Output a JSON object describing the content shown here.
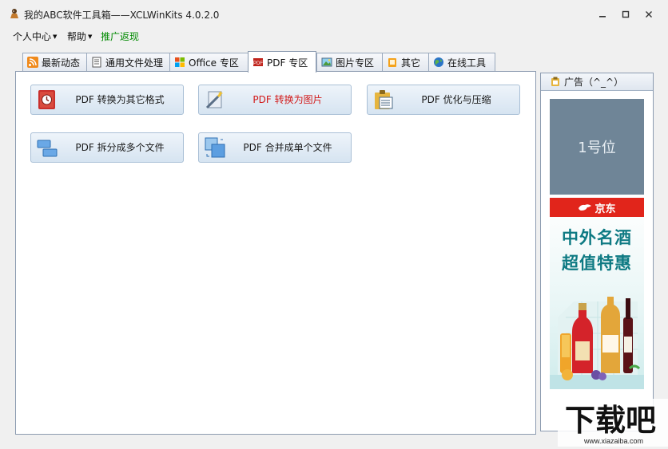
{
  "window": {
    "title": "我的ABC软件工具箱——XCLWinKits  4.0.2.0",
    "minimize": "—",
    "maximize": "□",
    "close": "✕"
  },
  "menu": {
    "personal": "个人中心",
    "help": "帮助",
    "promo": "推广返现"
  },
  "tabs": [
    {
      "label": "最新动态",
      "icon": "rss-icon"
    },
    {
      "label": "通用文件处理",
      "icon": "document-icon"
    },
    {
      "label": "Office 专区",
      "icon": "office-icon"
    },
    {
      "label": "PDF 专区",
      "icon": "pdf-icon"
    },
    {
      "label": "图片专区",
      "icon": "picture-icon"
    },
    {
      "label": "其它",
      "icon": "folder-icon"
    },
    {
      "label": "在线工具",
      "icon": "globe-icon"
    }
  ],
  "active_tab": "PDF 专区",
  "pdf_tools": [
    {
      "label": "PDF 转换为其它格式",
      "icon": "convert-format-icon"
    },
    {
      "label": "PDF 转换为图片",
      "icon": "magic-wand-icon",
      "color": "#d21919"
    },
    {
      "label": "PDF 优化与压缩",
      "icon": "clipboard-icon"
    },
    {
      "label": "PDF 拆分成多个文件",
      "icon": "split-icon"
    },
    {
      "label": "PDF 合并成单个文件",
      "icon": "merge-icon"
    }
  ],
  "ad": {
    "header": "广告（^_^）",
    "slot1": "1号位",
    "jd_brand": "京东",
    "line1": "中外名酒",
    "line2": "超值特惠"
  },
  "watermark": {
    "main": "下载吧",
    "url": "www.xiazaiba.com"
  },
  "colors": {
    "accent_red": "#d21919",
    "promo_green": "#008a00",
    "ad_slot_gray": "#6f8597",
    "jd_red": "#e1251b",
    "ad_teal": "#0e7a83"
  }
}
